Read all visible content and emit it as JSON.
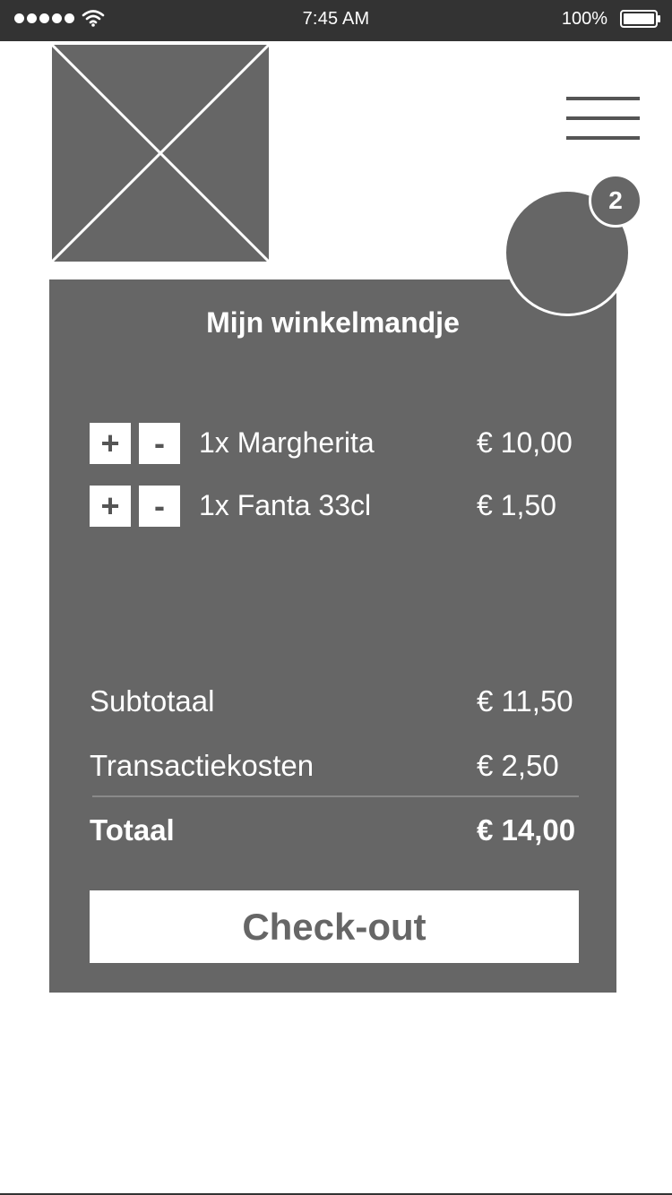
{
  "status_bar": {
    "time": "7:45 AM",
    "battery": "100%"
  },
  "menu": {
    "icon": "hamburger-icon"
  },
  "cart": {
    "badge_count": "2",
    "title": "Mijn winkelmandje",
    "items": [
      {
        "name": "1x Margherita",
        "price": "€ 10,00",
        "plus_label": "+",
        "minus_label": "-"
      },
      {
        "name": "1x Fanta 33cl",
        "price": "€ 1,50",
        "plus_label": "+",
        "minus_label": "-"
      }
    ],
    "subtotal_label": "Subtotaal",
    "subtotal_value": "€ 11,50",
    "fee_label": "Transactiekosten",
    "fee_value": "€ 2,50",
    "total_label": "Totaal",
    "total_value": "€ 14,00",
    "checkout_label": "Check-out"
  },
  "colors": {
    "status_bar": "#333333",
    "panel": "#666666",
    "text_light": "#ffffff"
  }
}
